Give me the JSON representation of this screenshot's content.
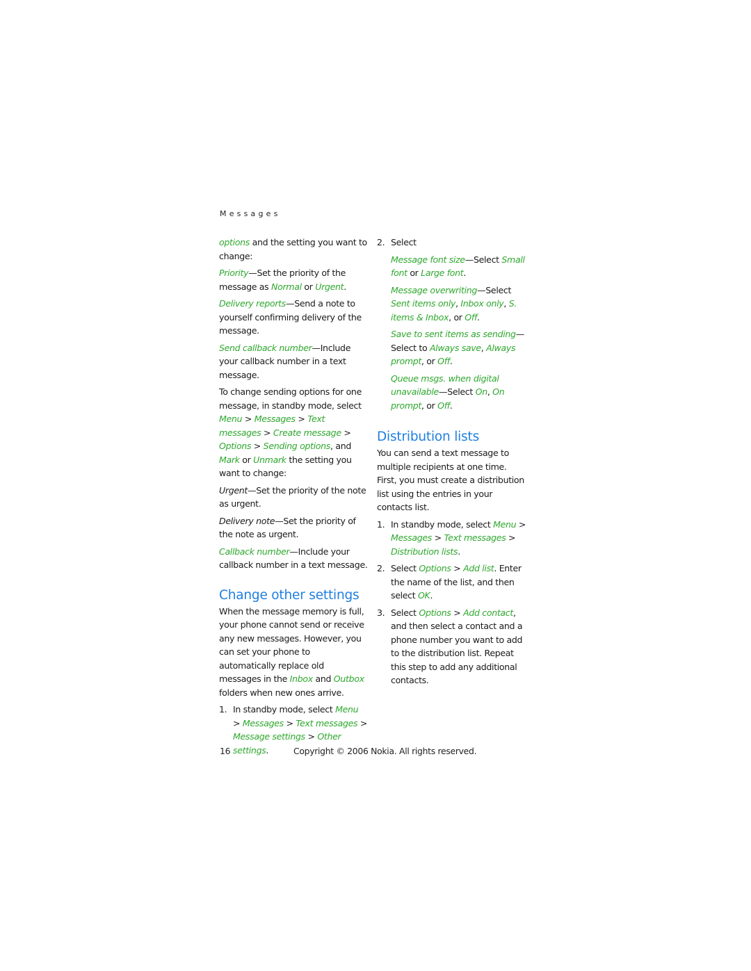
{
  "running_head": "Messages",
  "accent_colors": {
    "link_green": "#2fa82f",
    "heading_blue": "#1f7fe0"
  },
  "left_column": {
    "p1": {
      "g1": "options",
      "t1": " and the setting you want to change:"
    },
    "priority": {
      "g1": "Priority",
      "t1": "—Set the priority of the message as ",
      "g2": "Normal",
      "t2": " or ",
      "g3": "Urgent",
      "t3": "."
    },
    "delivery_reports": {
      "g1": "Delivery reports",
      "t1": "—Send a note to yourself confirming delivery of the message."
    },
    "send_callback": {
      "g1": "Send callback number",
      "t1": "—Include your callback number in a text message."
    },
    "change_sending": {
      "t1": "To change sending options for one message, in standby mode, select ",
      "g1": "Menu",
      "s1": " > ",
      "g2": "Messages",
      "s2": " > ",
      "g3": "Text messages",
      "s3": " > ",
      "g4": "Create message",
      "s4": " > ",
      "g5": "Options",
      "s5": " > ",
      "g6": "Sending options",
      "t2": ", and ",
      "g7": "Mark",
      "t3": " or ",
      "g8": "Unmark",
      "t4": " the setting you want to change:"
    },
    "urgent": {
      "i1": "Urgent",
      "t1": "—Set the priority of the note as urgent."
    },
    "delivery_note": {
      "i1": "Delivery note",
      "t1": "—Set the priority of the note as urgent."
    },
    "callback_number": {
      "g1": "Callback number",
      "t1": "—Include your callback number in a text message."
    },
    "heading": "Change other settings",
    "memory": {
      "t1": "When the message memory is full, your phone cannot send or receive any new messages. However, you can set your phone to automatically replace old messages in the ",
      "g1": "Inbox",
      "t2": " and ",
      "g2": "Outbox",
      "t3": " folders when new ones arrive."
    },
    "step1": {
      "num": "1.",
      "t1": "In standby mode, select ",
      "g1": "Menu",
      "s1": " > ",
      "g2": "Messages",
      "s2": " > ",
      "g3": "Text messages",
      "s3": " > ",
      "g4": "Message settings",
      "s4": " > ",
      "g5": "Other settings",
      "t2": "."
    }
  },
  "right_column": {
    "step2": {
      "num": "2.",
      "t1": "Select ",
      "g1": "Options",
      "s1": " > ",
      "g2": "Add list",
      "t2": ". Enter the name of the list, and then select ",
      "g3": "OK",
      "t3": "."
    },
    "font_size": {
      "g1": "Message font size",
      "t1": "—Select ",
      "g2": "Small font",
      "t2": " or ",
      "g3": "Large font",
      "t3": "."
    },
    "overwriting": {
      "g1": "Message overwriting",
      "t1": "—Select ",
      "g2": "Sent items only",
      "t2": ", ",
      "g3": "Inbox only",
      "t3": ", ",
      "g4": "S. items & Inbox",
      "t4": ", or ",
      "g5": "Off",
      "t5": "."
    },
    "save_sent": {
      "g1": "Save to sent items as sending",
      "t1": "— Select to ",
      "g2": "Always save",
      "t2": ", ",
      "g3": "Always prompt",
      "t3": ", or ",
      "g4": "Off",
      "t4": "."
    },
    "queue": {
      "g1": "Queue msgs. when digital unavailable",
      "t1": "—Select ",
      "g2": "On",
      "t2": ", ",
      "g3": "On prompt",
      "t3": ", or ",
      "g4": "Off",
      "t4": "."
    },
    "heading": "Distribution lists",
    "intro": "You can send a text message to multiple recipients at one time. First, you must create a distribution list using the entries in your contacts list.",
    "step1": {
      "num": "1.",
      "t1": "In standby mode, select ",
      "g1": "Menu",
      "s1": " > ",
      "g2": "Messages",
      "s2": " > ",
      "g3": "Text messages",
      "s3": " > ",
      "g4": "Distribution lists",
      "t2": "."
    },
    "step3": {
      "num": "3.",
      "t1": "Select ",
      "g1": "Options",
      "s1": " > ",
      "g2": "Add contact",
      "t2": ", and then select a contact and a phone number you want to add to the distribution list. Repeat this step to add any additional contacts."
    }
  },
  "footer": {
    "page_number": "16",
    "copyright": "Copyright © 2006 Nokia. All rights reserved."
  }
}
